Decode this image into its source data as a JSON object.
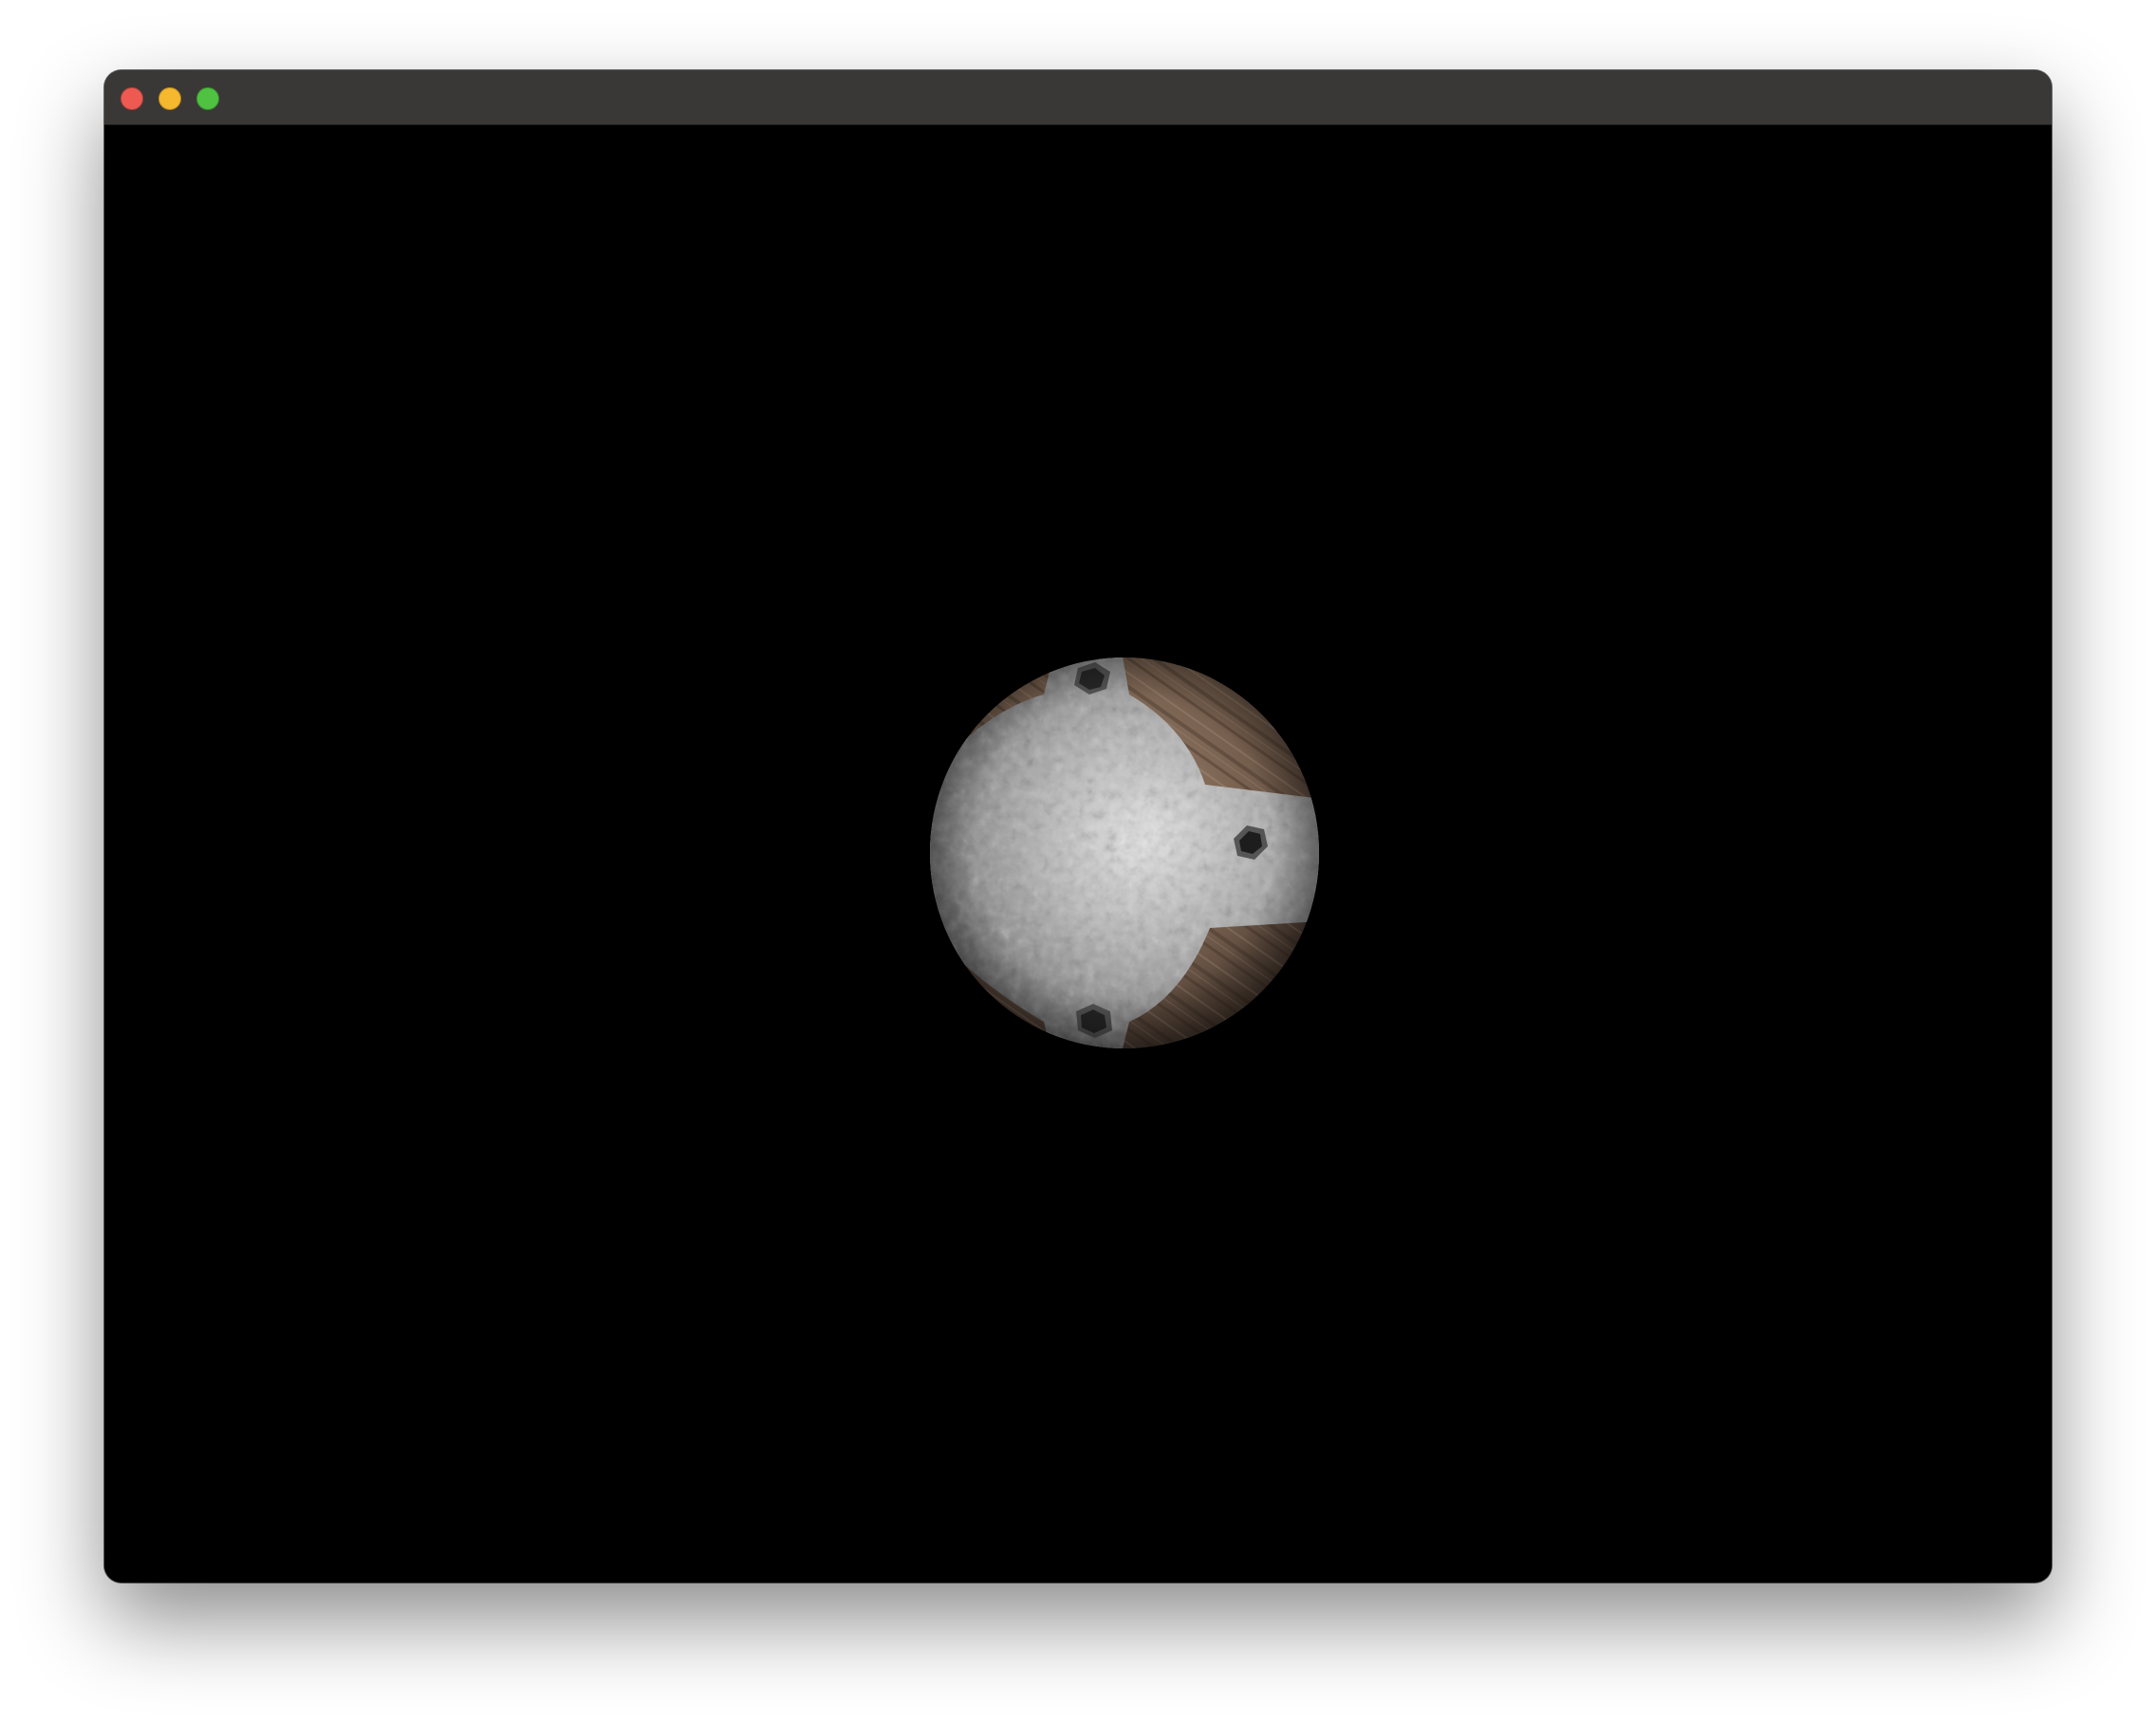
{
  "window": {
    "controls": [
      {
        "name": "close-button",
        "color": "#ee5a52"
      },
      {
        "name": "minimize-button",
        "color": "#f5b82e"
      },
      {
        "name": "zoom-button",
        "color": "#4fc242"
      }
    ]
  },
  "scene": {
    "background": "#000000",
    "object": "textured-sphere",
    "materials": {
      "metal": "#b9b9b9",
      "wood": "#8a6a55"
    }
  }
}
